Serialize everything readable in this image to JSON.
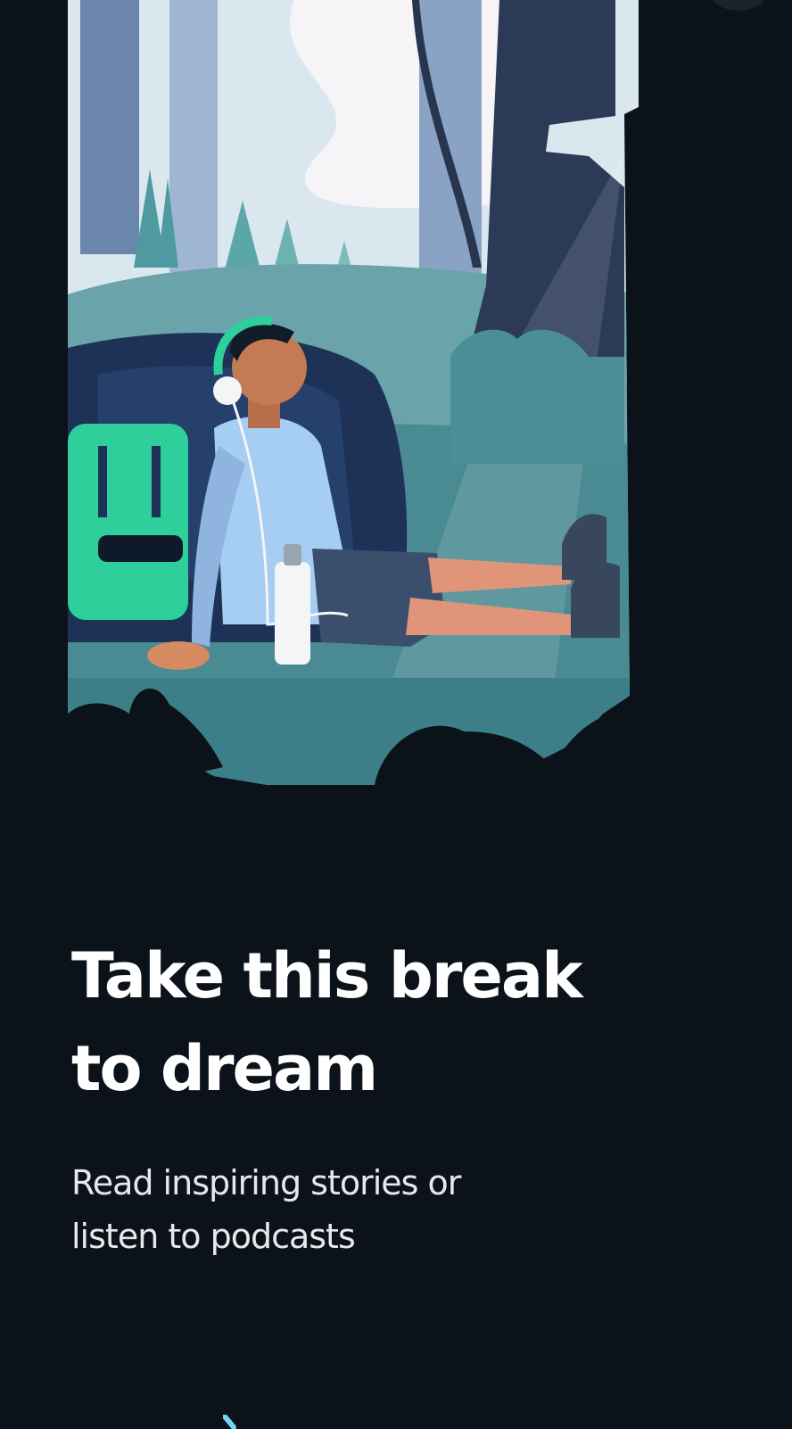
{
  "onboarding": {
    "headline_line1": "Take this break",
    "headline_line2": "to dream",
    "subtitle_line1": "Read inspiring stories or",
    "subtitle_line2": "listen to podcasts"
  },
  "illustration": {
    "subject": "person-relaxing-with-headphones-in-forest"
  },
  "colors": {
    "background": "#0b1219",
    "headline": "#ffffff",
    "subtitle": "#e6e9ec",
    "accent_teal": "#2ecf9a"
  }
}
